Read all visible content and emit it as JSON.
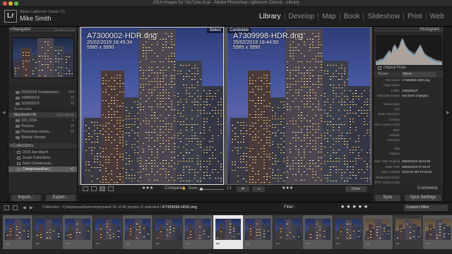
{
  "window": {
    "title": "2019 Images for YouTube.lrcat - Adobe Photoshop Lightroom Classic - Library"
  },
  "identity": {
    "app_sub": "Adobe Lightroom Classic CC",
    "user": "Mike Smith",
    "logo": "Lr"
  },
  "modules": [
    "Library",
    "Develop",
    "Map",
    "Book",
    "Slideshow",
    "Print",
    "Web"
  ],
  "active_module": "Library",
  "navigator": {
    "title": "Navigator",
    "zoom": "FIT FILL 1:1 3:1"
  },
  "folders": [
    {
      "name": "20190328 Compressed...",
      "count": "234"
    },
    {
      "name": "100MSDCF",
      "count": "11"
    },
    {
      "name": "101MSDCF",
      "count": "11"
    }
  ],
  "bookmarks": {
    "label": "Bookmarks"
  },
  "volume": {
    "name": "Macintosh HD",
    "stats": "82.9 / 465 GB"
  },
  "volume_folders": [
    {
      "name": "100_0165",
      "count": "1"
    },
    {
      "name": "Pictures",
      "count": "15"
    },
    {
      "name": "Photoshop tutoria...",
      "count": "15"
    },
    {
      "name": "Weekly Version",
      "count": ""
    }
  ],
  "collections": {
    "title": "Collections",
    "items": [
      {
        "name": "2019 Jan-March",
        "count": ""
      },
      {
        "name": "Smart Collections",
        "count": ""
      },
      {
        "name": "Astro Compressio...",
        "count": ""
      },
      {
        "name": "Compressed/unc...",
        "count": "42"
      }
    ]
  },
  "left_buttons": {
    "import": "Import...",
    "export": "Export..."
  },
  "compare": {
    "select_label": "Select",
    "candidate_label": "Candidate",
    "left": {
      "filename": "A7300002-HDR.dng",
      "date": "25/02/2019 18:45:34",
      "dims": "5985 x 3990"
    },
    "right": {
      "filename": "A7309998-HDR.dng",
      "date": "25/02/2019 18:44:50",
      "dims": "5985 x 3990"
    }
  },
  "toolbar": {
    "compare": "Compare",
    "zoom": "Zoom",
    "zoom_value": "1:1",
    "done": "Done",
    "stars_left": "★★★",
    "stars_right": "★★★"
  },
  "histogram": {
    "title": "Histogram",
    "iso": "ISO 100",
    "original_photo": "Original Photo",
    "levels": [
      2,
      3,
      4,
      6,
      5,
      7,
      10,
      14,
      18,
      20,
      16,
      24,
      30,
      28,
      22,
      26,
      34,
      40,
      38,
      30,
      26,
      22,
      20,
      18,
      16,
      14,
      18,
      22,
      26,
      30,
      24,
      18,
      14,
      12,
      10,
      9,
      8,
      6,
      5,
      4,
      3,
      3,
      2,
      2
    ]
  },
  "metadata": {
    "preset_label": "Preset",
    "preset_value": "None",
    "rows": [
      {
        "k": "File Name",
        "v": "A7309998-HDR.dng"
      },
      {
        "k": "Copy Name",
        "v": ""
      },
      {
        "k": "Folder",
        "v": "100MSDCF"
      },
      {
        "k": "Metadata Status",
        "v": "Has been changed"
      }
    ],
    "rows2": [
      {
        "k": "Sublocation",
        "v": ""
      },
      {
        "k": "City",
        "v": ""
      },
      {
        "k": "State / Province",
        "v": ""
      },
      {
        "k": "Country",
        "v": ""
      },
      {
        "k": "ISO Country Code",
        "v": ""
      },
      {
        "k": "GPS",
        "v": ""
      },
      {
        "k": "Altitude",
        "v": ""
      },
      {
        "k": "Direction",
        "v": ""
      }
    ],
    "rows3": [
      {
        "k": "Title",
        "v": ""
      },
      {
        "k": "Caption",
        "v": ""
      }
    ],
    "rows4": [
      {
        "k": "Date Time Original",
        "v": "25/02/2019 18:44:50"
      },
      {
        "k": "Date Time",
        "v": "28/03/2019 07:42:47"
      },
      {
        "k": "Date Created",
        "v": "2019-02-25T18:44:50"
      },
      {
        "k": "Intellectual Genre",
        "v": ""
      },
      {
        "k": "IPTC Scene Code",
        "v": ""
      }
    ]
  },
  "right_bottom": {
    "comments": "Comments",
    "sync": "Sync",
    "sync_settings": "Sync Settings"
  },
  "filmstrip_bar": {
    "path_prefix": "Collection : Compressed/uncompressed",
    "count": "32 of 42 photos /2 selected /",
    "current": "A7309998-HDR.dng",
    "filter_label": "Filter :",
    "stars": "★ ★ ★ ★ ★",
    "custom_filter": "Custom Filter"
  },
  "filmstrip": {
    "thumb_count": 15,
    "selected_index": 7
  }
}
